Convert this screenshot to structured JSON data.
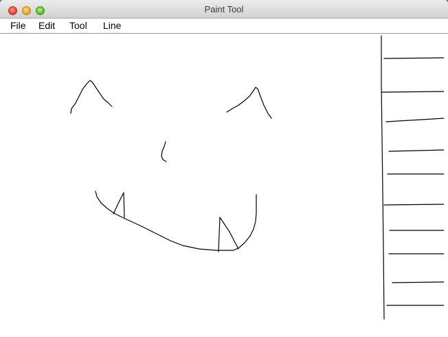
{
  "window": {
    "title": "Paint Tool"
  },
  "menubar": {
    "items": [
      {
        "label": "File"
      },
      {
        "label": "Edit"
      },
      {
        "label": "Tool"
      },
      {
        "label": "Line"
      }
    ]
  },
  "canvas": {
    "background": "#ffffff",
    "stroke_color": "#000000"
  }
}
